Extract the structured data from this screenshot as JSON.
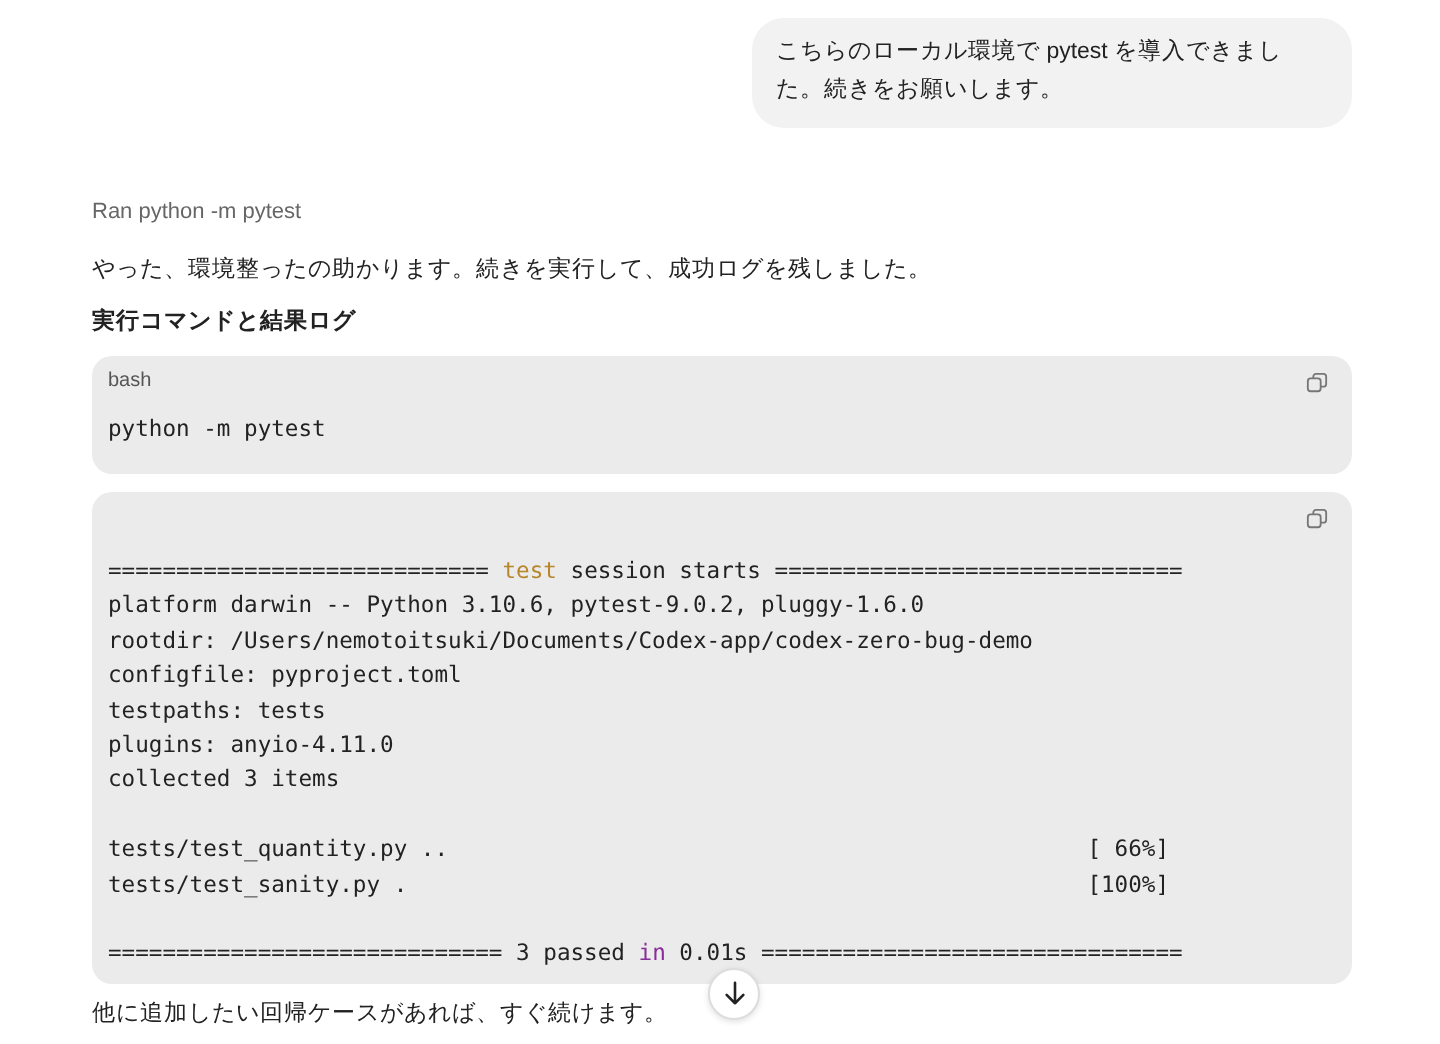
{
  "user_message": {
    "text": "こちらのローカル環境で pytest を導入できました。続きをお願いします。"
  },
  "assistant": {
    "tool_run": "Ran python -m pytest",
    "intro": "やった、環境整ったの助かります。続きを実行して、成功ログを残しました。",
    "heading": "実行コマンドと結果ログ",
    "command_block": {
      "language": "bash",
      "code": "python -m pytest"
    },
    "log_block": {
      "lines": [
        {
          "kind": "text",
          "segments": [
            {
              "kind": "plain",
              "text": "============================ "
            },
            {
              "kind": "keyword",
              "text": "test"
            },
            {
              "kind": "plain",
              "text": " session starts =============================="
            }
          ]
        },
        {
          "kind": "text",
          "segments": [
            {
              "kind": "plain",
              "text": "platform darwin -- Python 3.10.6, pytest-9.0.2, pluggy-1.6.0"
            }
          ]
        },
        {
          "kind": "text",
          "segments": [
            {
              "kind": "plain",
              "text": "rootdir: /Users/nemotoitsuki/Documents/Codex-app/codex-zero-bug-demo"
            }
          ]
        },
        {
          "kind": "text",
          "segments": [
            {
              "kind": "plain",
              "text": "configfile: pyproject.toml"
            }
          ]
        },
        {
          "kind": "text",
          "segments": [
            {
              "kind": "plain",
              "text": "testpaths: tests"
            }
          ]
        },
        {
          "kind": "text",
          "segments": [
            {
              "kind": "plain",
              "text": "plugins: anyio-4.11.0"
            }
          ]
        },
        {
          "kind": "text",
          "segments": [
            {
              "kind": "plain",
              "text": "collected 3 items"
            }
          ]
        },
        {
          "kind": "blank"
        },
        {
          "kind": "result",
          "left": "tests/test_quantity.py ..",
          "right": "[ 66%]"
        },
        {
          "kind": "result",
          "left": "tests/test_sanity.py .",
          "right": "[100%]"
        },
        {
          "kind": "blank"
        },
        {
          "kind": "text",
          "segments": [
            {
              "kind": "plain",
              "text": "============================= 3 passed "
            },
            {
              "kind": "builtin",
              "text": "in"
            },
            {
              "kind": "plain",
              "text": " 0.01s ==============================="
            }
          ]
        }
      ]
    },
    "closing": "他に追加したい回帰ケースがあれば、すぐ続けます。"
  }
}
